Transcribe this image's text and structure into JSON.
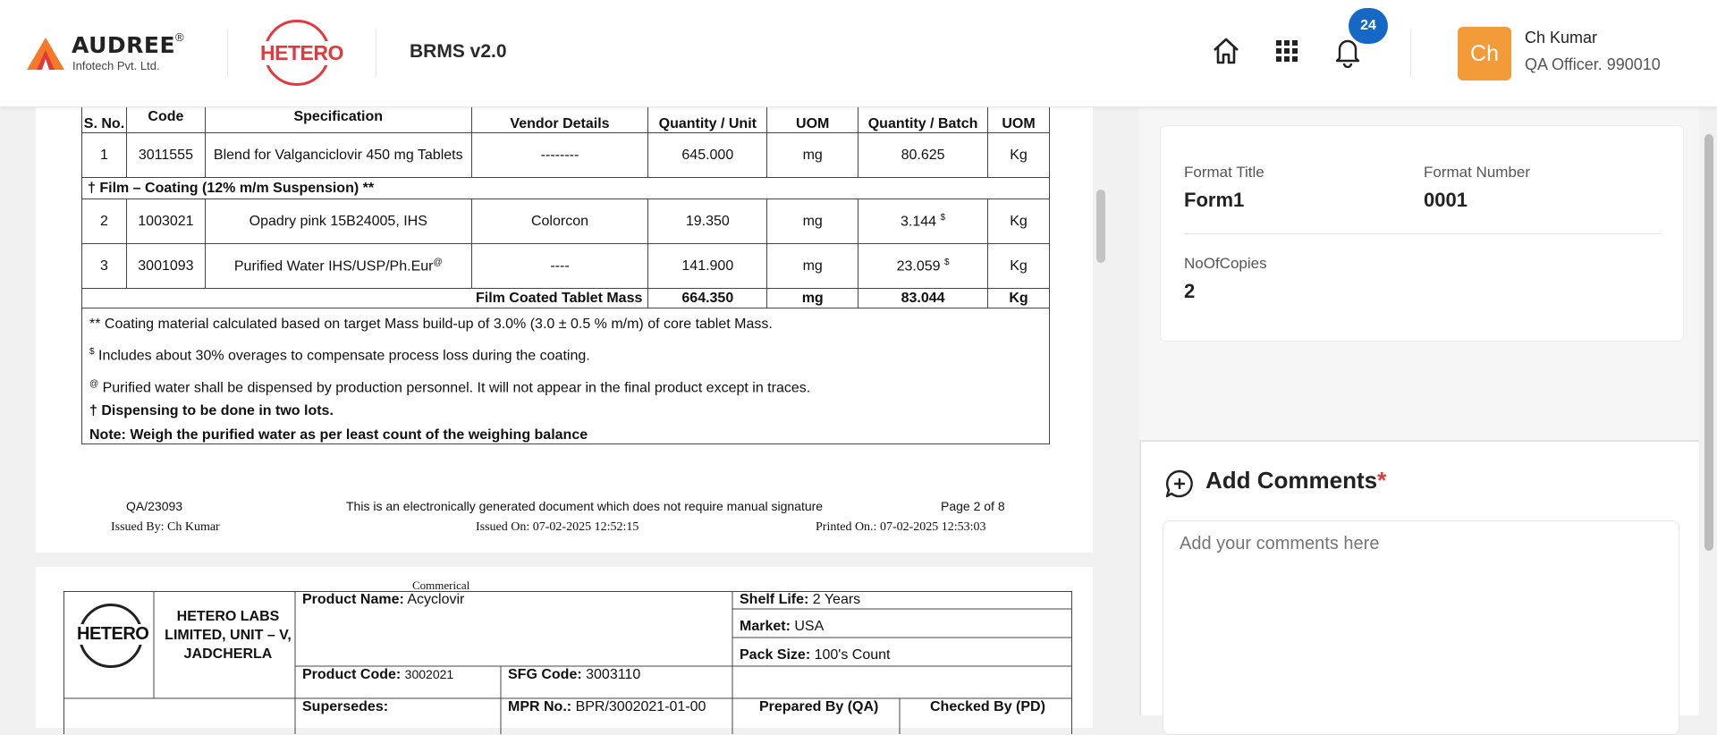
{
  "header": {
    "company": "AUDREE",
    "company_reg": "®",
    "company_sub": "Infotech Pvt. Ltd.",
    "client_logo": "HETERO",
    "app_title": "BRMS v2.0",
    "notification_count": "24",
    "user": {
      "initials": "Ch",
      "name": "Ch Kumar",
      "role": "QA Officer. 990010"
    },
    "icons": [
      "home-icon",
      "apps-grid-icon",
      "bell-icon"
    ]
  },
  "document": {
    "page1": {
      "header_row": [
        "S. No.",
        "Code",
        "Specification",
        "Vendor Details",
        "Quantity / Unit",
        "UOM",
        "Quantity / Batch",
        "UOM"
      ],
      "rows": [
        {
          "sno": "1",
          "code": "3011555",
          "spec": "Blend for Valganciclovir 450 mg Tablets",
          "vendor": "--------",
          "qty_unit": "645.000",
          "uom1": "mg",
          "qty_batch": "80.625",
          "batch_sup": "",
          "uom2": "Kg"
        },
        {
          "section": "† Film – Coating (12% m/m Suspension) **"
        },
        {
          "sno": "2",
          "code": "1003021",
          "spec": "Opadry pink 15B24005, IHS",
          "vendor": "Colorcon",
          "qty_unit": "19.350",
          "uom1": "mg",
          "qty_batch": "3.144",
          "batch_sup": "$",
          "uom2": "Kg"
        },
        {
          "sno": "3",
          "code": "3001093",
          "spec": "Purified Water IHS/USP/Ph.Eur",
          "spec_sup": "@",
          "vendor": "----",
          "qty_unit": "141.900",
          "uom1": "mg",
          "qty_batch": "23.059",
          "batch_sup": "$",
          "uom2": "Kg"
        }
      ],
      "total": {
        "label": "Film Coated Tablet Mass",
        "qty_unit": "664.350",
        "uom1": "mg",
        "qty_batch": "83.044",
        "uom2": "Kg"
      },
      "notes": [
        "** Coating material calculated based on target Mass build-up of 3.0% (3.0 ± 0.5 % m/m) of core tablet Mass.",
        "Includes about 30% overages to compensate process loss during the coating.",
        "Purified water shall be dispensed by production personnel. It will not appear in the final product except in traces.",
        "† Dispensing to be done in two lots.",
        "Note: Weigh the purified water as per least count of the weighing balance"
      ],
      "note_marks": [
        "$",
        "@"
      ],
      "footer": {
        "doc_no": "QA/23093",
        "disclaimer": "This is an electronically generated document which does not require manual signature",
        "page": "Page 2 of 8",
        "issued_by": "Issued By: Ch  Kumar",
        "issued_on": "Issued On: 07-02-2025 12:52:15",
        "printed_on": "Printed On.: 07-02-2025 12:53:03"
      }
    },
    "page2": {
      "category": "Commerical",
      "logo": "HETERO",
      "company": "HETERO LABS LIMITED, UNIT – V, JADCHERLA",
      "product_name_label": "Product Name:",
      "product_name": "Acyclovir",
      "shelf_life_label": "Shelf Life:",
      "shelf_life": "2 Years",
      "market_label": "Market:",
      "market": "USA",
      "pack_size_label": "Pack Size:",
      "pack_size": "100's Count",
      "product_code_label": "Product Code:",
      "product_code": "3002021",
      "sfg_code_label": "SFG Code:",
      "sfg_code": "3003110",
      "supersedes_label": "Supersedes:",
      "mpr_label": "MPR No.:",
      "mpr_no": "BPR/3002021-01-00",
      "prepared_by": "Prepared By (QA)",
      "checked_by": "Checked By (PD)"
    }
  },
  "format": {
    "title_label": "Format Title",
    "title": "Form1",
    "number_label": "Format Number",
    "number": "0001",
    "copies_label": "NoOfCopies",
    "copies": "2"
  },
  "comments": {
    "title": "Add Comments",
    "required_mark": "*",
    "placeholder": "Add your comments here"
  },
  "colors": {
    "brand_orange": "#f29b38",
    "hetero_red": "#e03a3c",
    "badge_blue": "#1668c7"
  }
}
